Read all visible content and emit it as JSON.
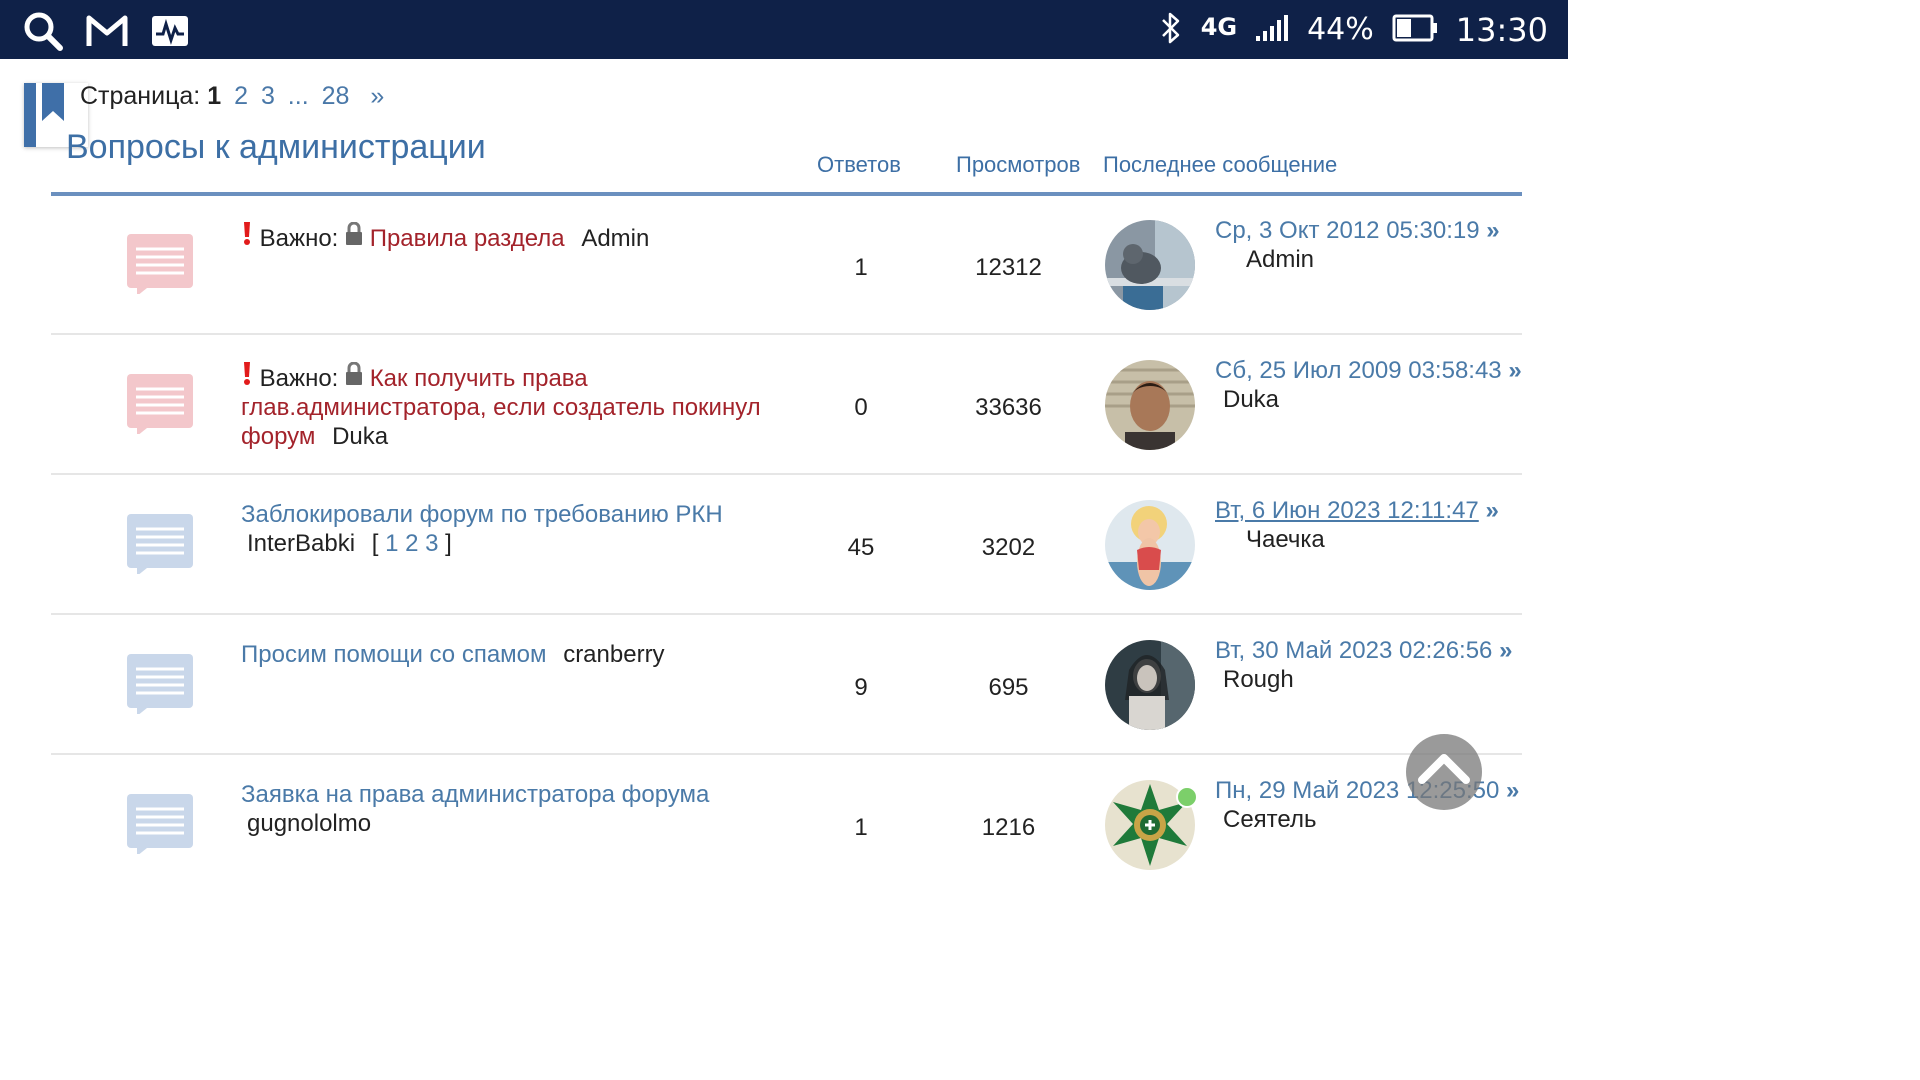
{
  "status_bar": {
    "network": "4G",
    "battery": "44%",
    "time": "13:30"
  },
  "pagination": {
    "label": "Страница:",
    "current": "1",
    "pages": [
      "2",
      "3"
    ],
    "ellipsis": "...",
    "last": "28",
    "next": "»"
  },
  "forum": {
    "title": "Вопросы к администрации",
    "col_replies": "Ответов",
    "col_views": "Просмотров",
    "col_last": "Последнее сообщение"
  },
  "topics": [
    {
      "important": "Важно:",
      "title": "Правила раздела",
      "author": "Admin",
      "replies": "1",
      "views": "12312",
      "last_date": "Ср, 3 Окт 2012 05:30:19",
      "last_arrow": "»",
      "last_user": "Admin"
    },
    {
      "important": "Важно:",
      "title": "Как получить права глав.администратора, если создатель покинул форум",
      "author": "Duka",
      "replies": "0",
      "views": "33636",
      "last_date": "Сб, 25 Июл 2009 03:58:43",
      "last_arrow": "»",
      "last_user": "Duka"
    },
    {
      "title": "Заблокировали форум по требованию РКН",
      "author": "InterBabki",
      "pages_open": "[",
      "pages": [
        "1",
        "2",
        "3"
      ],
      "pages_close": "]",
      "replies": "45",
      "views": "3202",
      "last_date": "Вт, 6 Июн 2023 12:11:47",
      "last_arrow": "»",
      "last_user": "Чаечка"
    },
    {
      "title": "Просим помощи со спамом",
      "author": "cranberry",
      "replies": "9",
      "views": "695",
      "last_date": "Вт, 30 Май 2023 02:26:56",
      "last_arrow": "»",
      "last_user": "Rough"
    },
    {
      "title": "Заявка на права администратора форума",
      "author": "gugnololmo",
      "replies": "1",
      "views": "1216",
      "last_date": "Пн, 29 Май 2023 12:25:50",
      "last_arrow": "»",
      "last_user": "Сеятель"
    }
  ],
  "colors": {
    "status_bar": "#0f2148",
    "link": "#4a7aa8",
    "important_title": "#a3232b",
    "header_line": "#6b90bf",
    "icon_read_important": "#f3c7cb",
    "icon_read": "#c9d7ea"
  }
}
